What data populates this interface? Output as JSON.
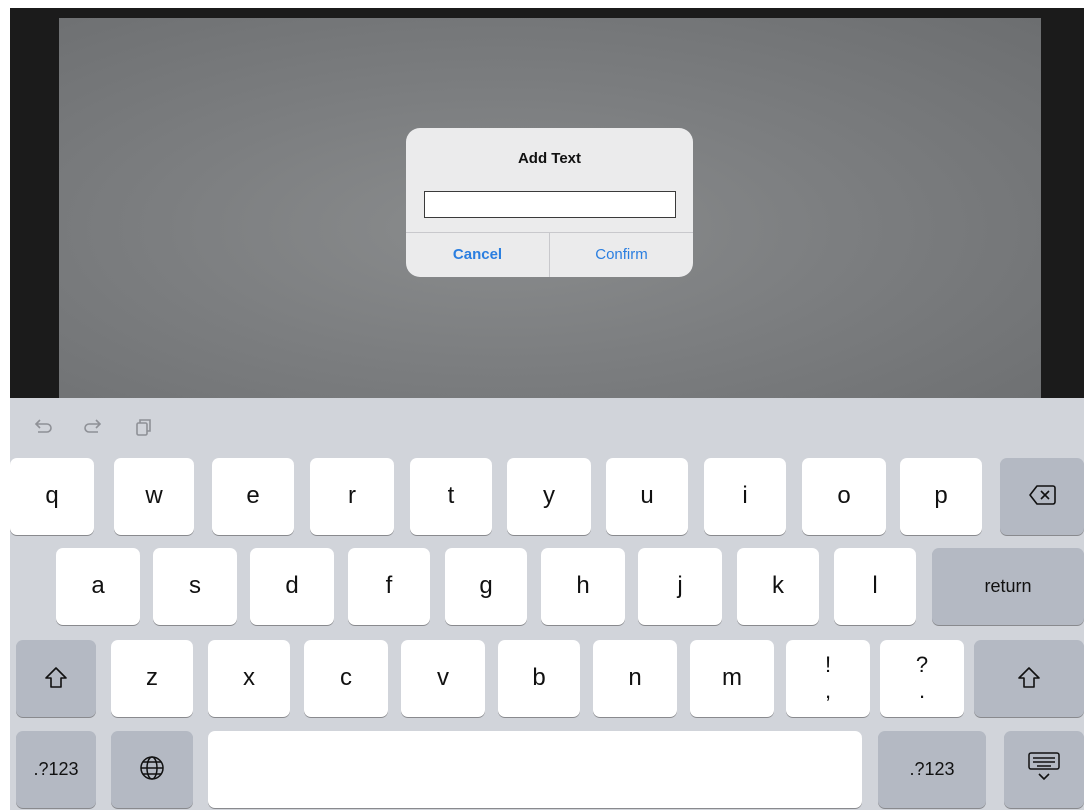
{
  "alert": {
    "title": "Add Text",
    "input_value": "",
    "cancel_label": "Cancel",
    "confirm_label": "Confirm"
  },
  "toolbar": {
    "undo_icon": "undo-icon",
    "redo_icon": "redo-icon",
    "paste_icon": "paste-icon"
  },
  "keyboard": {
    "row1": [
      "q",
      "w",
      "e",
      "r",
      "t",
      "y",
      "u",
      "i",
      "o",
      "p"
    ],
    "row2": [
      "a",
      "s",
      "d",
      "f",
      "g",
      "h",
      "j",
      "k",
      "l"
    ],
    "row3": [
      "z",
      "x",
      "c",
      "v",
      "b",
      "n",
      "m"
    ],
    "exclaim_top": "!",
    "exclaim_bottom": ",",
    "question_top": "?",
    "question_bottom": ".",
    "return_label": "return",
    "numbers_label_left": ".?123",
    "numbers_label_right": ".?123",
    "space_label": ""
  },
  "colors": {
    "accent": "#2a7ee0",
    "keyboard_bg": "#d1d4da",
    "func_key": "#b4b9c3"
  }
}
